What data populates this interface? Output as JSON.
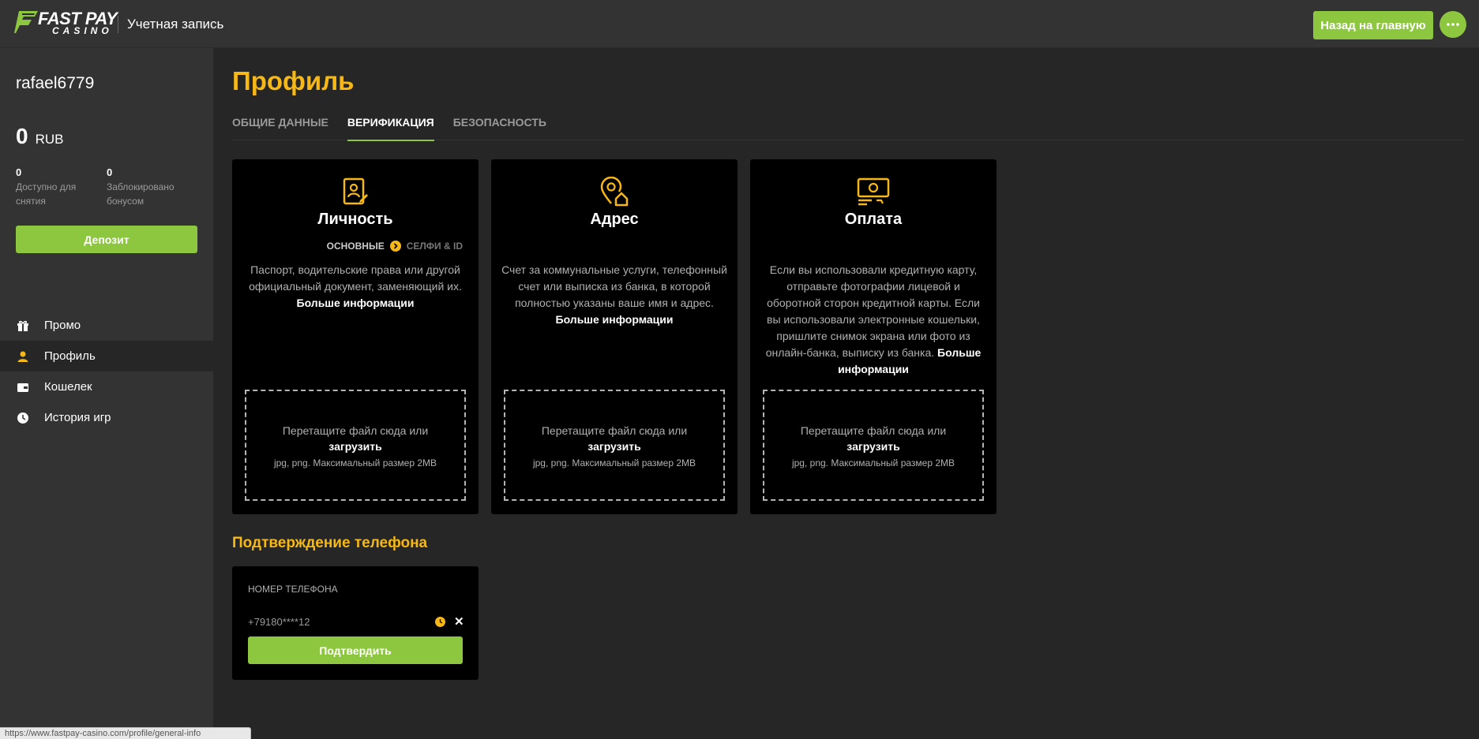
{
  "header": {
    "logo_main": "FAST PAY",
    "logo_sub": "CASINO",
    "title": "Учетная запись",
    "home_button": "Назад на главную",
    "more_icon": "dots-icon"
  },
  "sidebar": {
    "username": "rafael6779",
    "balance": "0",
    "currency": "RUB",
    "available_value": "0",
    "available_label": "Доступно для снятия",
    "blocked_value": "0",
    "blocked_label": "Заблокировано бонусом",
    "deposit_button": "Депозит",
    "nav": [
      {
        "label": "Промо",
        "icon": "gift-icon"
      },
      {
        "label": "Профиль",
        "icon": "user-icon"
      },
      {
        "label": "Кошелек",
        "icon": "wallet-icon"
      },
      {
        "label": "История игр",
        "icon": "clock-icon"
      }
    ]
  },
  "main": {
    "title": "Профиль",
    "tabs": [
      {
        "label": "ОБЩИЕ ДАННЫЕ"
      },
      {
        "label": "ВЕРИФИКАЦИЯ"
      },
      {
        "label": "БЕЗОПАСНОСТЬ"
      }
    ],
    "cards": [
      {
        "title": "Личность",
        "icon": "id-document-icon",
        "step1": "ОСНОВНЫЕ",
        "step2": "СЕЛФИ & ID",
        "desc": "Паспорт, водительские права или другой официальный документ, заменяющий их.",
        "more": "Больше информации"
      },
      {
        "title": "Адрес",
        "icon": "location-home-icon",
        "desc": "Счет за коммунальные услуги, телефонный счет или выписка из банка, в которой полностью указаны ваше имя и адрес.",
        "more": "Больше информации"
      },
      {
        "title": "Оплата",
        "icon": "payment-card-icon",
        "desc": "Если вы использовали кредитную карту, отправьте фотографии лицевой и оборотной сторон кредитной карты. Если вы использовали электронные кошельки, пришлите снимок экрана или фото из онлайн-банка, выписку из банка.",
        "more": "Больше информации"
      }
    ],
    "dropzone": {
      "text": "Перетащите файл сюда или",
      "upload": "загрузить",
      "hint": "jpg, png. Максимальный размер 2MB"
    },
    "phone": {
      "section_title": "Подтверждение телефона",
      "label": "НОМЕР ТЕЛЕФОНА",
      "value": "+79180****12",
      "confirm_button": "Подтвердить"
    }
  },
  "statusbar": {
    "url": "https://www.fastpay-casino.com/profile/general-info"
  },
  "colors": {
    "accent_green": "#8dc63f",
    "accent_yellow": "#f5b817",
    "background": "#262626",
    "panel": "#333333"
  }
}
